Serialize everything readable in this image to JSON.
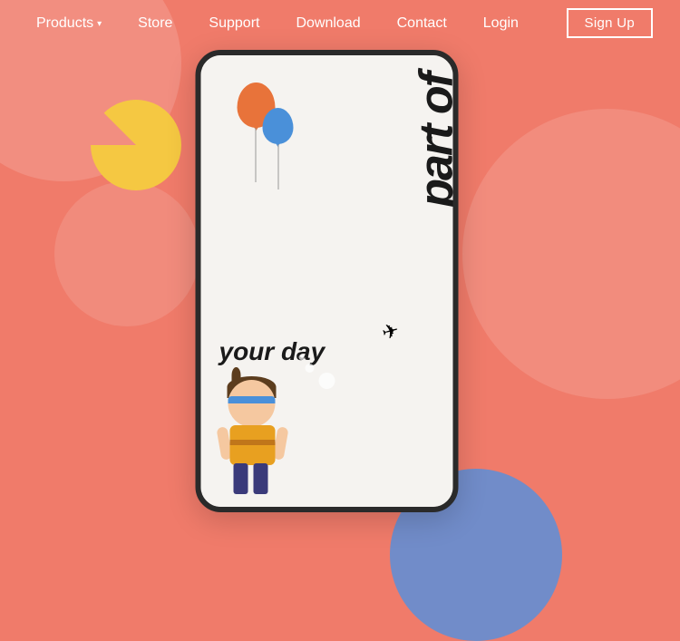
{
  "nav": {
    "items": [
      {
        "label": "Products",
        "hasDropdown": true
      },
      {
        "label": "Store",
        "hasDropdown": false
      },
      {
        "label": "Support",
        "hasDropdown": false
      },
      {
        "label": "Download",
        "hasDropdown": false
      },
      {
        "label": "Contact",
        "hasDropdown": false
      },
      {
        "label": "Login",
        "hasDropdown": false
      }
    ],
    "signup_label": "Sign Up"
  },
  "hero": {
    "vertical_text": "part of",
    "your_day_text": "your day"
  },
  "colors": {
    "background": "#F07B6A",
    "nav_text": "#ffffff",
    "device_bg": "#f5f3f0"
  }
}
